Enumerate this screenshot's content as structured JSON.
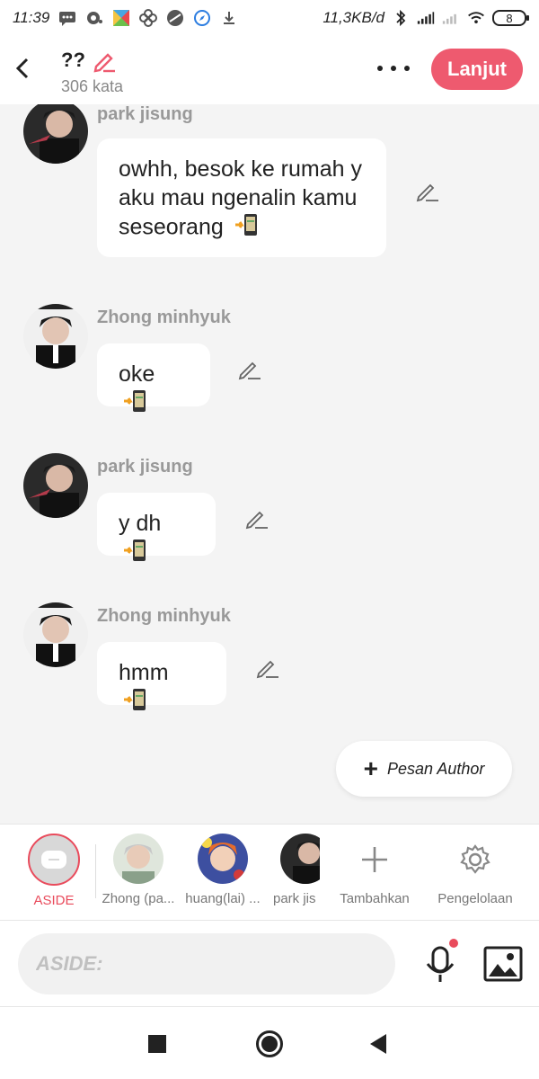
{
  "status_bar": {
    "time": "11:39",
    "net_speed": "11,3KB/d",
    "battery": "8"
  },
  "header": {
    "title": "??",
    "word_count": "306 kata",
    "next_button": "Lanjut"
  },
  "messages": [
    {
      "sender": "park jisung",
      "text": "owhh, besok ke rumah y aku mau ngenalin kamu seseorang"
    },
    {
      "sender": "Zhong minhyuk",
      "text": "oke"
    },
    {
      "sender": "park jisung",
      "text": "y dh"
    },
    {
      "sender": "Zhong minhyuk",
      "text": "hmm"
    }
  ],
  "author_button": "Pesan Author",
  "characters": [
    {
      "label": "ASIDE",
      "active": true
    },
    {
      "label": "Zhong (pa..."
    },
    {
      "label": "huang(lai) ..."
    },
    {
      "label": "park jis"
    }
  ],
  "tools": {
    "add_label": "Tambahkan",
    "manage_label": "Pengelolaan"
  },
  "composer": {
    "placeholder": "ASIDE:"
  },
  "colors": {
    "accent": "#ee5a6f",
    "background": "#f4f4f4"
  }
}
